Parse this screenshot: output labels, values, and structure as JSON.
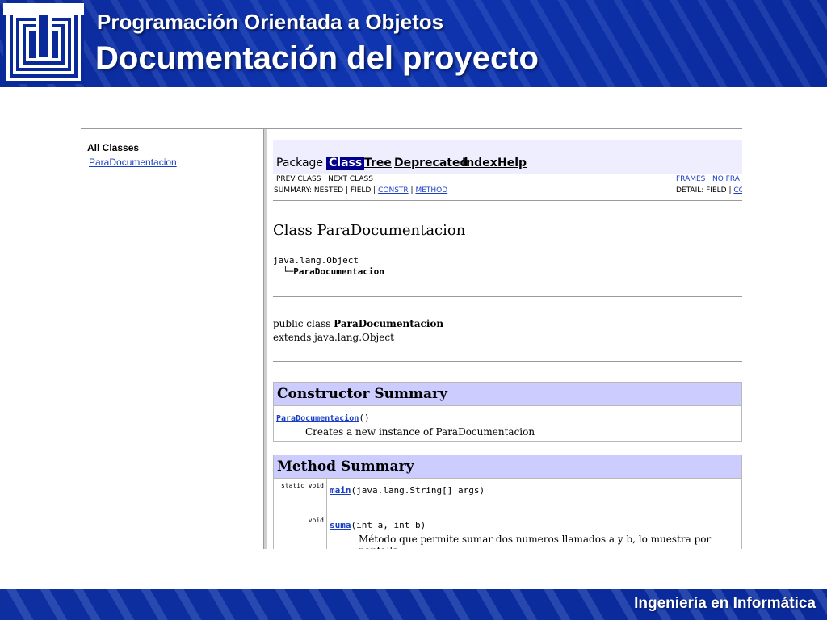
{
  "header": {
    "course_title": "Programación Orientada a Objetos",
    "slide_title": "Documentación del proyecto"
  },
  "footer": {
    "text": "Ingeniería en Informática"
  },
  "javadoc": {
    "left_frame": {
      "heading": "All Classes",
      "class_link": "ParaDocumentacion"
    },
    "navbar": {
      "package": "Package",
      "class": "Class",
      "tree": "Tree",
      "deprecated": "Deprecated",
      "index": "Index",
      "help": "Help"
    },
    "subnav": {
      "prev_class": "PREV CLASS",
      "next_class": "NEXT CLASS",
      "frames": "FRAMES",
      "no_frames": "NO FRA",
      "summary_prefix": "SUMMARY: NESTED | FIELD |",
      "constr": "CONSTR",
      "sep": "|",
      "method": "METHOD",
      "detail_prefix": "DETAIL: FIELD |",
      "detail_link": "CO"
    },
    "class_heading": "Class ParaDocumentacion",
    "inheritance": {
      "parent": "java.lang.Object",
      "child": "ParaDocumentacion",
      "connector": "└─"
    },
    "declaration": {
      "prefix": "public class ",
      "name": "ParaDocumentacion",
      "extends": "extends java.lang.Object"
    },
    "constructor_summary": {
      "title": "Constructor Summary",
      "constructor_name": "ParaDocumentacion",
      "constructor_params": "()",
      "constructor_desc": "Creates a new instance of ParaDocumentacion"
    },
    "method_summary": {
      "title": "Method Summary",
      "methods": [
        {
          "modifier": "static void",
          "name": "main",
          "params": "(java.lang.String[] args)",
          "desc": ""
        },
        {
          "modifier": "void",
          "name": "suma",
          "params": "(int a, int b)",
          "desc": "Método que permite sumar dos numeros llamados a y b, lo muestra por pantalla"
        }
      ]
    }
  }
}
